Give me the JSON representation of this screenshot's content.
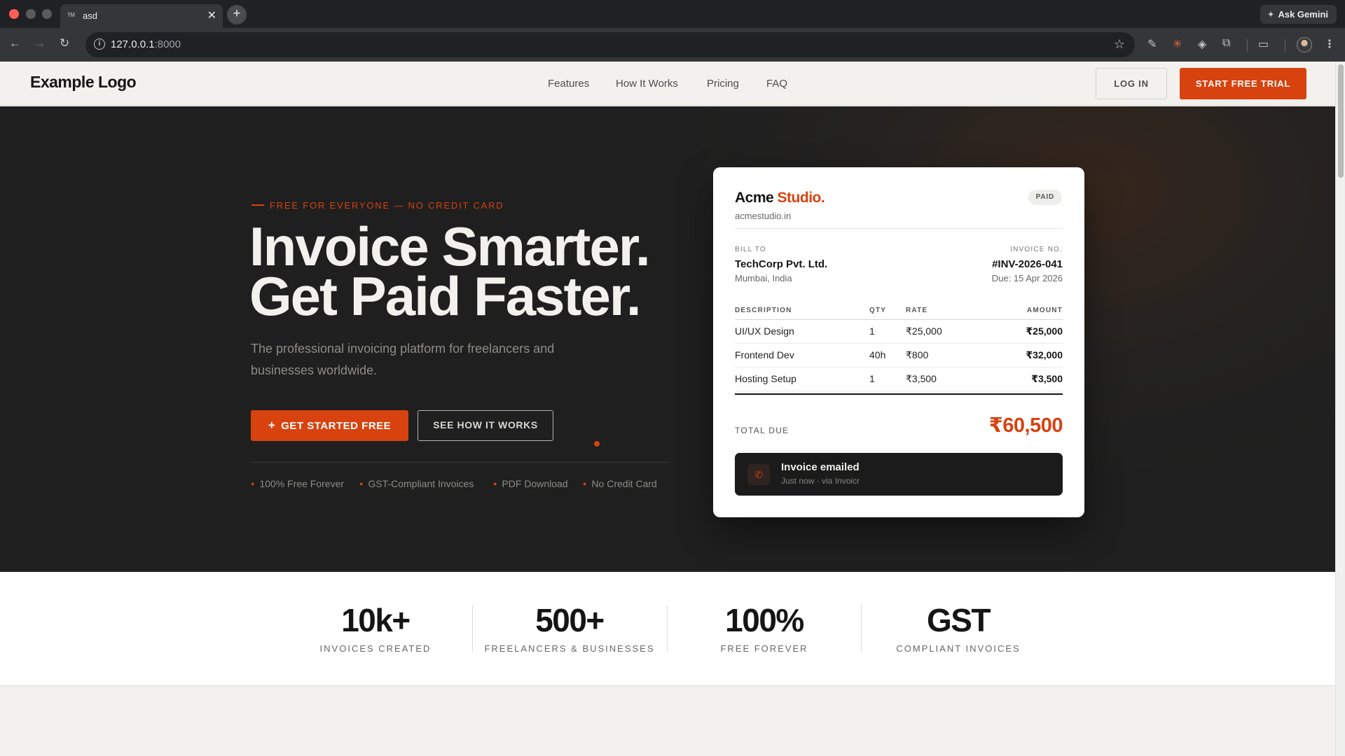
{
  "browser": {
    "tab_title": "asd",
    "tab_favicon": "TM",
    "url_host": "127.0.0.1",
    "url_port": ":8000",
    "ask_gemini": "Ask Gemini"
  },
  "header": {
    "logo": "Example Logo",
    "nav": [
      "Features",
      "How It Works",
      "Pricing",
      "FAQ"
    ],
    "login": "LOG IN",
    "cta": "START FREE TRIAL"
  },
  "hero": {
    "eyebrow": "FREE FOR EVERYONE — NO CREDIT CARD",
    "headline_line1": "Invoice Smarter.",
    "headline_line2": "Get Paid Faster.",
    "subtitle": "The professional invoicing platform for freelancers and businesses worldwide.",
    "primary_cta": "GET STARTED FREE",
    "secondary_cta": "SEE HOW IT WORKS",
    "features": [
      "100% Free Forever",
      "GST-Compliant Invoices",
      "PDF Download",
      "No Credit Card"
    ]
  },
  "invoice": {
    "company": "Acme",
    "company_accent": "Studio.",
    "domain": "acmestudio.in",
    "status": "PAID",
    "bill_to_label": "BILL TO",
    "bill_to_name": "TechCorp Pvt. Ltd.",
    "bill_to_city": "Mumbai, India",
    "invoice_no_label": "INVOICE NO.",
    "invoice_no": "#INV-2026-041",
    "due": "Due: 15 Apr 2026",
    "columns": [
      "DESCRIPTION",
      "QTY",
      "RATE",
      "AMOUNT"
    ],
    "items": [
      {
        "description": "UI/UX Design",
        "qty": "1",
        "rate": "₹25,000",
        "amount": "₹25,000"
      },
      {
        "description": "Frontend Dev",
        "qty": "40h",
        "rate": "₹800",
        "amount": "₹32,000"
      },
      {
        "description": "Hosting Setup",
        "qty": "1",
        "rate": "₹3,500",
        "amount": "₹3,500"
      }
    ],
    "total_label": "TOTAL DUE",
    "total": "₹60,500",
    "toast_title": "Invoice emailed",
    "toast_sub": "Just now · via Invoicr"
  },
  "stats": [
    {
      "value": "10k+",
      "label": "INVOICES CREATED"
    },
    {
      "value": "500+",
      "label": "FREELANCERS & BUSINESSES"
    },
    {
      "value": "100%",
      "label": "FREE FOREVER"
    },
    {
      "value": "GST",
      "label": "COMPLIANT INVOICES"
    }
  ],
  "colors": {
    "accent": "#d8420f",
    "hero_bg": "#1f1f1f",
    "page_bg": "#f3f1ee"
  }
}
